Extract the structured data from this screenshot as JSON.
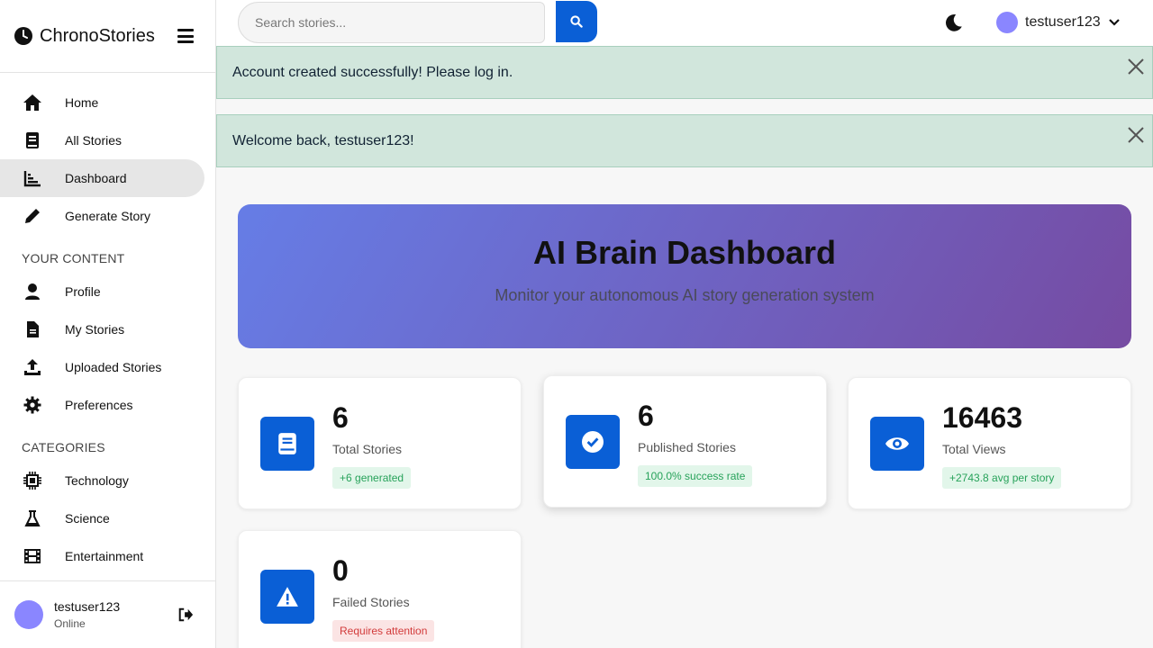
{
  "brand": {
    "name": "ChronoStories"
  },
  "nav": {
    "main": [
      {
        "label": "Home",
        "icon": "home-icon"
      },
      {
        "label": "All Stories",
        "icon": "book-icon"
      },
      {
        "label": "Dashboard",
        "icon": "chart-icon",
        "active": true
      },
      {
        "label": "Generate Story",
        "icon": "pencil-icon"
      }
    ],
    "your_content_title": "YOUR CONTENT",
    "your_content": [
      {
        "label": "Profile",
        "icon": "user-icon"
      },
      {
        "label": "My Stories",
        "icon": "file-icon"
      },
      {
        "label": "Uploaded Stories",
        "icon": "upload-icon"
      },
      {
        "label": "Preferences",
        "icon": "gear-icon"
      }
    ],
    "categories_title": "CATEGORIES",
    "categories": [
      {
        "label": "Technology",
        "icon": "chip-icon"
      },
      {
        "label": "Science",
        "icon": "flask-icon"
      },
      {
        "label": "Entertainment",
        "icon": "film-icon"
      }
    ]
  },
  "sidebar_footer": {
    "username": "testuser123",
    "status": "Online"
  },
  "search": {
    "placeholder": "Search stories..."
  },
  "user_menu": {
    "username": "testuser123"
  },
  "alerts": [
    {
      "message": "Account created successfully! Please log in."
    },
    {
      "message": "Welcome back, testuser123!"
    }
  ],
  "hero": {
    "title": "AI Brain Dashboard",
    "subtitle": "Monitor your autonomous AI story generation system"
  },
  "stats": [
    {
      "value": "6",
      "label": "Total Stories",
      "badge": "+6 generated",
      "badge_type": "good",
      "icon": "book-icon"
    },
    {
      "value": "6",
      "label": "Published Stories",
      "badge": "100.0% success rate",
      "badge_type": "good",
      "icon": "check-circle-icon"
    },
    {
      "value": "16463",
      "label": "Total Views",
      "badge": "+2743.8 avg per story",
      "badge_type": "good",
      "icon": "eye-icon"
    },
    {
      "value": "0",
      "label": "Failed Stories",
      "badge": "Requires attention",
      "badge_type": "bad",
      "icon": "warning-icon"
    }
  ],
  "colors": {
    "accent": "#0a5fd6",
    "alert_bg": "#d1e6dc",
    "hero_start": "#667de6",
    "hero_end": "#764ba2"
  }
}
